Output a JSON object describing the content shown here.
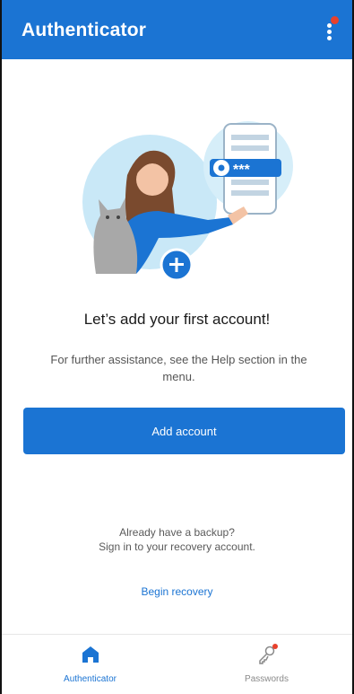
{
  "header": {
    "title": "Authenticator",
    "menu_icon": "more-vert-icon",
    "notification_color": "#e8412c"
  },
  "colors": {
    "accent": "#1b74d3",
    "notification": "#e8412c"
  },
  "main": {
    "headline": "Let’s add your first account!",
    "help_text": "For further assistance, see the Help section in the menu.",
    "add_account_label": "Add account",
    "backup_line1": "Already have a backup?",
    "backup_line2": "Sign in to your recovery account.",
    "recovery_link": "Begin recovery"
  },
  "bottom_nav": {
    "items": [
      {
        "label": "Authenticator",
        "icon": "home-icon",
        "active": true
      },
      {
        "label": "Passwords",
        "icon": "key-icon",
        "active": false,
        "badge": true
      }
    ]
  },
  "illustration": {
    "password_mask": "***"
  }
}
